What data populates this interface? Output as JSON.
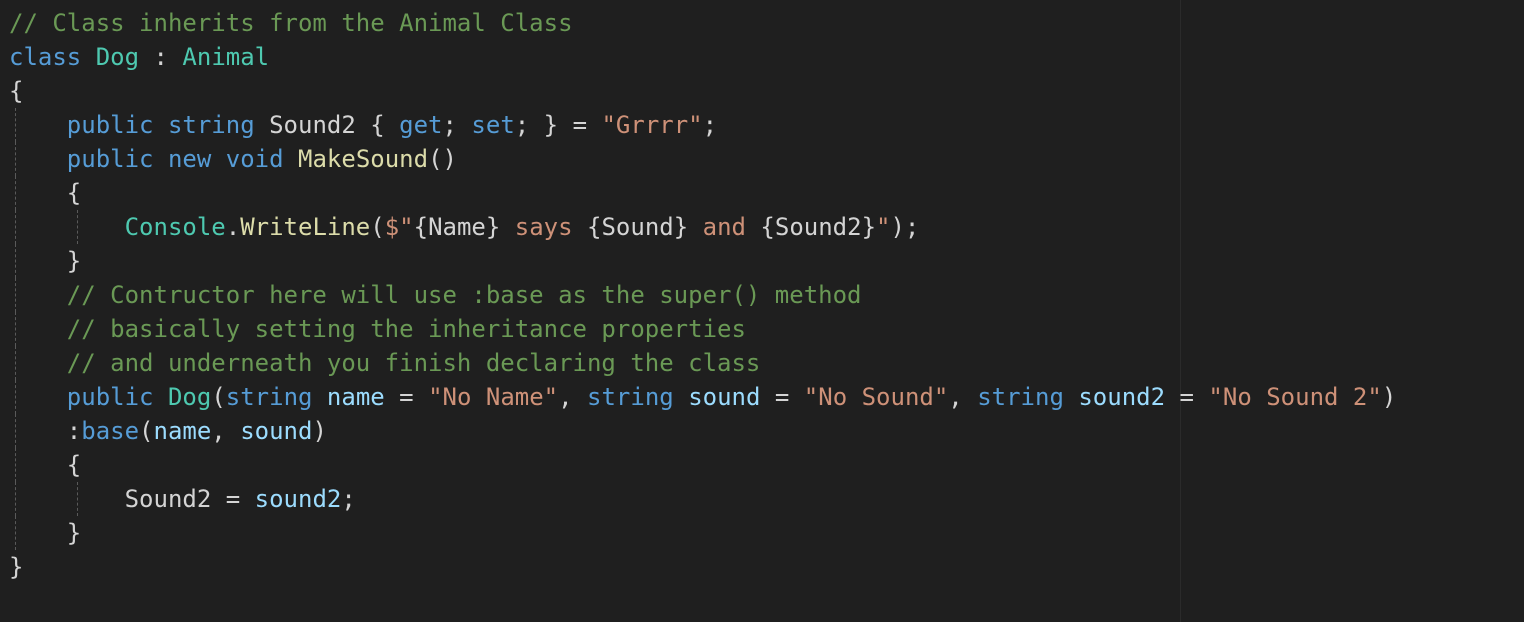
{
  "editor": {
    "language": "C#",
    "theme": {
      "background": "#1f1f1f",
      "ruler": "#2b2b2b",
      "indent_guide": "#5a5a5a"
    },
    "colors": {
      "comment": "#6a9955",
      "keyword": "#569cd6",
      "type": "#4ec9b0",
      "method": "#dcdcaa",
      "string": "#ce9178",
      "variable": "#9cdcfe",
      "punctuation": "#d4d4d4",
      "plain": "#d4d4d4"
    },
    "lines": [
      {
        "indent": 0,
        "guides": [],
        "tokens": [
          {
            "t": "// Class inherits from the Animal Class",
            "c": "comment"
          }
        ]
      },
      {
        "indent": 0,
        "guides": [],
        "tokens": [
          {
            "t": "class",
            "c": "keyword"
          },
          {
            "t": " ",
            "c": "plain"
          },
          {
            "t": "Dog",
            "c": "type"
          },
          {
            "t": " : ",
            "c": "punct"
          },
          {
            "t": "Animal",
            "c": "type"
          }
        ]
      },
      {
        "indent": 0,
        "guides": [],
        "tokens": [
          {
            "t": "{",
            "c": "punct"
          }
        ]
      },
      {
        "indent": 4,
        "guides": [
          0
        ],
        "tokens": [
          {
            "t": "public",
            "c": "keyword"
          },
          {
            "t": " ",
            "c": "plain"
          },
          {
            "t": "string",
            "c": "keyword"
          },
          {
            "t": " Sound2 { ",
            "c": "plain"
          },
          {
            "t": "get",
            "c": "keyword"
          },
          {
            "t": "; ",
            "c": "punct"
          },
          {
            "t": "set",
            "c": "keyword"
          },
          {
            "t": "; } = ",
            "c": "punct"
          },
          {
            "t": "\"Grrrr\"",
            "c": "string"
          },
          {
            "t": ";",
            "c": "punct"
          }
        ]
      },
      {
        "indent": 4,
        "guides": [
          0
        ],
        "tokens": [
          {
            "t": "public",
            "c": "keyword"
          },
          {
            "t": " ",
            "c": "plain"
          },
          {
            "t": "new",
            "c": "keyword"
          },
          {
            "t": " ",
            "c": "plain"
          },
          {
            "t": "void",
            "c": "keyword"
          },
          {
            "t": " ",
            "c": "plain"
          },
          {
            "t": "MakeSound",
            "c": "method"
          },
          {
            "t": "()",
            "c": "punct"
          }
        ]
      },
      {
        "indent": 4,
        "guides": [
          0
        ],
        "tokens": [
          {
            "t": "{",
            "c": "punct"
          }
        ]
      },
      {
        "indent": 8,
        "guides": [
          0,
          4
        ],
        "tokens": [
          {
            "t": "Console",
            "c": "type"
          },
          {
            "t": ".",
            "c": "punct"
          },
          {
            "t": "WriteLine",
            "c": "method"
          },
          {
            "t": "(",
            "c": "punct"
          },
          {
            "t": "$\"",
            "c": "string"
          },
          {
            "t": "{",
            "c": "punct"
          },
          {
            "t": "Name",
            "c": "plain"
          },
          {
            "t": "}",
            "c": "punct"
          },
          {
            "t": " says ",
            "c": "string"
          },
          {
            "t": "{",
            "c": "punct"
          },
          {
            "t": "Sound",
            "c": "plain"
          },
          {
            "t": "}",
            "c": "punct"
          },
          {
            "t": " and ",
            "c": "string"
          },
          {
            "t": "{",
            "c": "punct"
          },
          {
            "t": "Sound2",
            "c": "plain"
          },
          {
            "t": "}",
            "c": "punct"
          },
          {
            "t": "\"",
            "c": "string"
          },
          {
            "t": ");",
            "c": "punct"
          }
        ]
      },
      {
        "indent": 4,
        "guides": [
          0
        ],
        "tokens": [
          {
            "t": "}",
            "c": "punct"
          }
        ]
      },
      {
        "indent": 4,
        "guides": [
          0
        ],
        "tokens": [
          {
            "t": "// Contructor here will use :base as the super() method",
            "c": "comment"
          }
        ]
      },
      {
        "indent": 4,
        "guides": [
          0
        ],
        "tokens": [
          {
            "t": "// basically setting the inheritance properties",
            "c": "comment"
          }
        ]
      },
      {
        "indent": 4,
        "guides": [
          0
        ],
        "tokens": [
          {
            "t": "// and underneath you finish declaring the class",
            "c": "comment"
          }
        ]
      },
      {
        "indent": 4,
        "guides": [
          0
        ],
        "tokens": [
          {
            "t": "public",
            "c": "keyword"
          },
          {
            "t": " ",
            "c": "plain"
          },
          {
            "t": "Dog",
            "c": "type"
          },
          {
            "t": "(",
            "c": "punct"
          },
          {
            "t": "string",
            "c": "keyword"
          },
          {
            "t": " ",
            "c": "plain"
          },
          {
            "t": "name",
            "c": "var"
          },
          {
            "t": " = ",
            "c": "punct"
          },
          {
            "t": "\"No Name\"",
            "c": "string"
          },
          {
            "t": ", ",
            "c": "punct"
          },
          {
            "t": "string",
            "c": "keyword"
          },
          {
            "t": " ",
            "c": "plain"
          },
          {
            "t": "sound",
            "c": "var"
          },
          {
            "t": " = ",
            "c": "punct"
          },
          {
            "t": "\"No Sound\"",
            "c": "string"
          },
          {
            "t": ", ",
            "c": "punct"
          },
          {
            "t": "string",
            "c": "keyword"
          },
          {
            "t": " ",
            "c": "plain"
          },
          {
            "t": "sound2",
            "c": "var"
          },
          {
            "t": " = ",
            "c": "punct"
          },
          {
            "t": "\"No Sound 2\"",
            "c": "string"
          },
          {
            "t": ")",
            "c": "punct"
          }
        ]
      },
      {
        "indent": 4,
        "guides": [
          0
        ],
        "tokens": [
          {
            "t": ":",
            "c": "punct"
          },
          {
            "t": "base",
            "c": "keyword"
          },
          {
            "t": "(",
            "c": "punct"
          },
          {
            "t": "name",
            "c": "var"
          },
          {
            "t": ", ",
            "c": "punct"
          },
          {
            "t": "sound",
            "c": "var"
          },
          {
            "t": ")",
            "c": "punct"
          }
        ]
      },
      {
        "indent": 4,
        "guides": [
          0
        ],
        "tokens": [
          {
            "t": "{",
            "c": "punct"
          }
        ]
      },
      {
        "indent": 8,
        "guides": [
          0,
          4
        ],
        "tokens": [
          {
            "t": "Sound2 = ",
            "c": "plain"
          },
          {
            "t": "sound2",
            "c": "var"
          },
          {
            "t": ";",
            "c": "punct"
          }
        ]
      },
      {
        "indent": 4,
        "guides": [
          0
        ],
        "tokens": [
          {
            "t": "}",
            "c": "punct"
          }
        ]
      },
      {
        "indent": 0,
        "guides": [],
        "tokens": [
          {
            "t": "}",
            "c": "punct"
          }
        ]
      }
    ]
  }
}
